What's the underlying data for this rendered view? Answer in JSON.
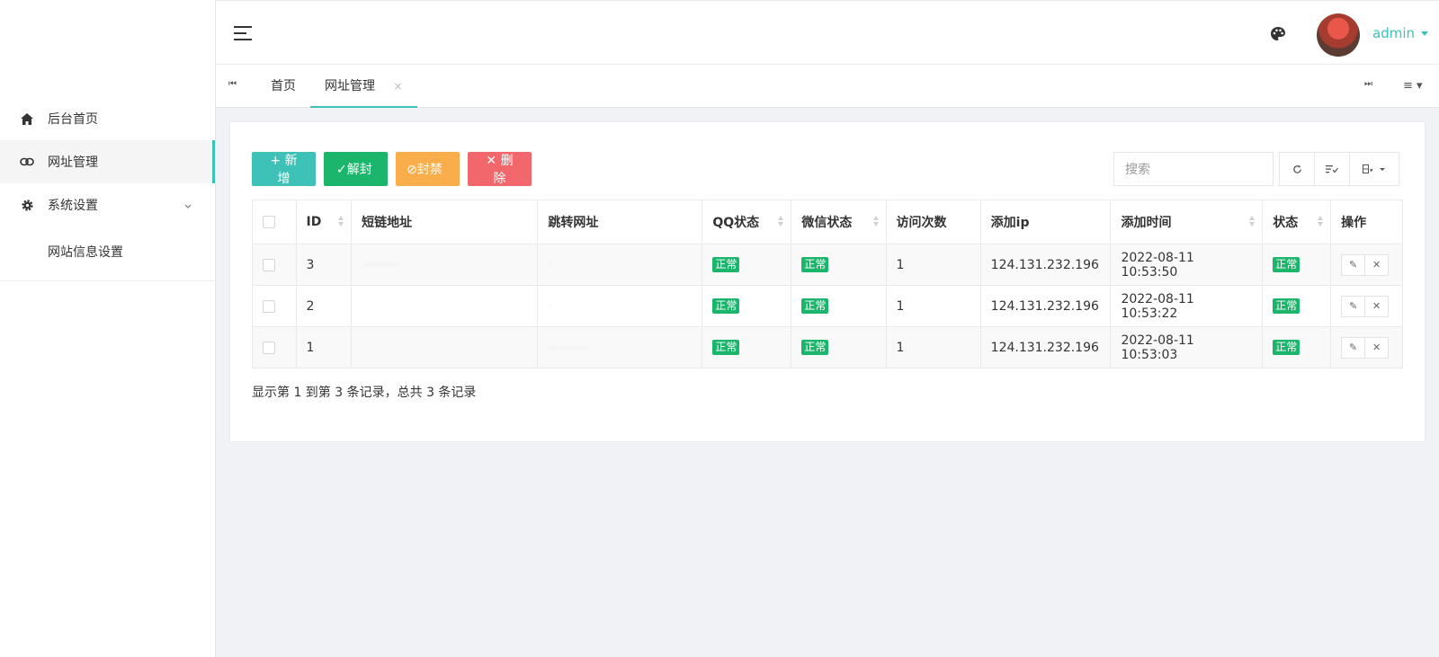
{
  "sidebar": {
    "items": [
      {
        "label": "后台首页",
        "icon": "home-icon"
      },
      {
        "label": "网址管理",
        "icon": "link-icon"
      },
      {
        "label": "系统设置",
        "icon": "gear-icon"
      }
    ],
    "submenu": [
      "网站信息设置"
    ]
  },
  "header": {
    "user": "admin"
  },
  "tabs": {
    "home": "首页",
    "active": "网址管理",
    "close": "×",
    "prev": "⏮",
    "next": "⏭",
    "menu": "≡ ▾"
  },
  "toolbar": {
    "add": "+ 新增",
    "unban": "✓解封",
    "ban": "⊘封禁",
    "delete": "✕ 删除",
    "search_placeholder": "搜索"
  },
  "table": {
    "columns": [
      "ID",
      "短链地址",
      "跳转网址",
      "QQ状态",
      "微信状态",
      "访问次数",
      "添加ip",
      "添加时间",
      "状态",
      "操作"
    ],
    "rows": [
      {
        "id": "3",
        "short": "···········",
        "target": "·",
        "qq": "正常",
        "wx": "正常",
        "visits": "1",
        "ip": "124.131.232.196",
        "time": "2022-08-11 10:53:50",
        "status": "正常"
      },
      {
        "id": "2",
        "short": "",
        "target": "·",
        "qq": "正常",
        "wx": "正常",
        "visits": "1",
        "ip": "124.131.232.196",
        "time": "2022-08-11 10:53:22",
        "status": "正常"
      },
      {
        "id": "1",
        "short": "",
        "target": "············",
        "qq": "正常",
        "wx": "正常",
        "visits": "1",
        "ip": "124.131.232.196",
        "time": "2022-08-11 10:53:03",
        "status": "正常"
      }
    ]
  },
  "summary": "显示第 1 到第 3 条记录，总共 3 条记录",
  "colors": {
    "accent": "#3ec1b6",
    "success": "#1bb66c",
    "warning": "#f9ad4b",
    "danger": "#f2676b"
  }
}
